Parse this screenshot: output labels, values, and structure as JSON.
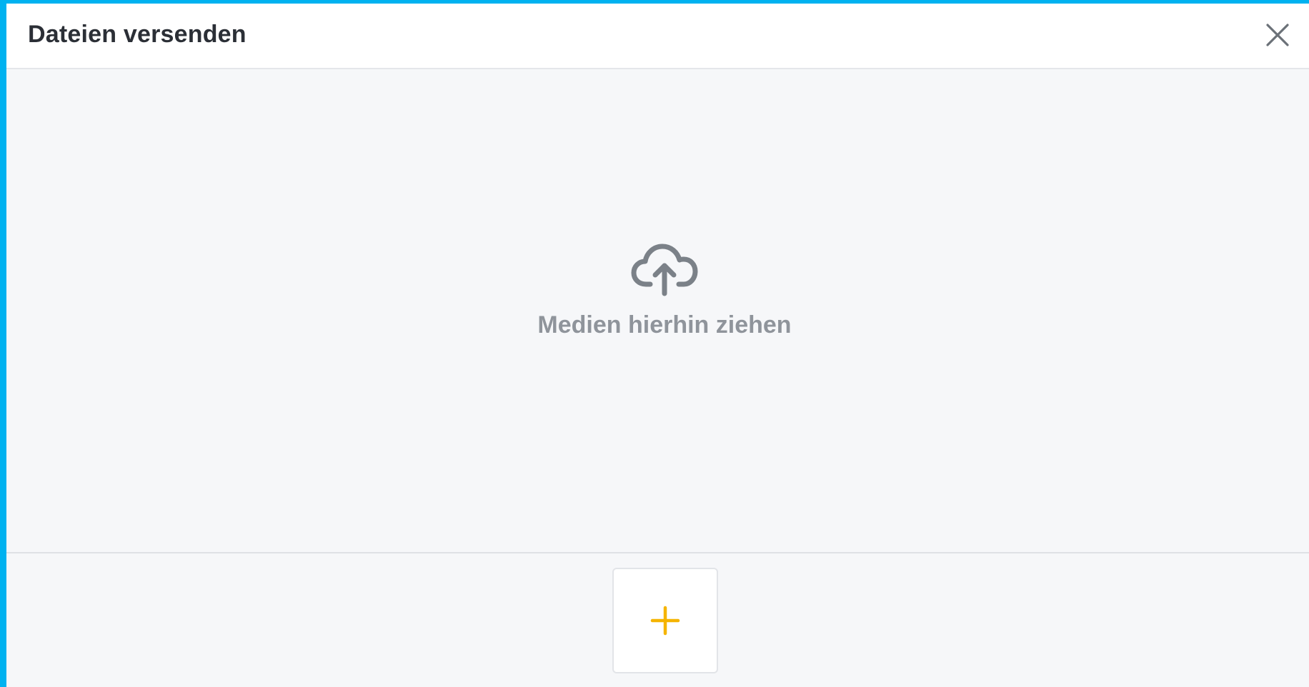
{
  "dialog": {
    "title": "Dateien versenden",
    "close_icon": "close-icon"
  },
  "dropzone": {
    "icon": "cloud-upload-icon",
    "text": "Medien hierhin ziehen"
  },
  "footer": {
    "add_icon": "plus-icon"
  },
  "colors": {
    "frame": "#00b2f0",
    "background": "#f6f7f9",
    "accent": "#f5b400",
    "muted_text": "#8f949b",
    "icon_gray": "#7b8188"
  }
}
